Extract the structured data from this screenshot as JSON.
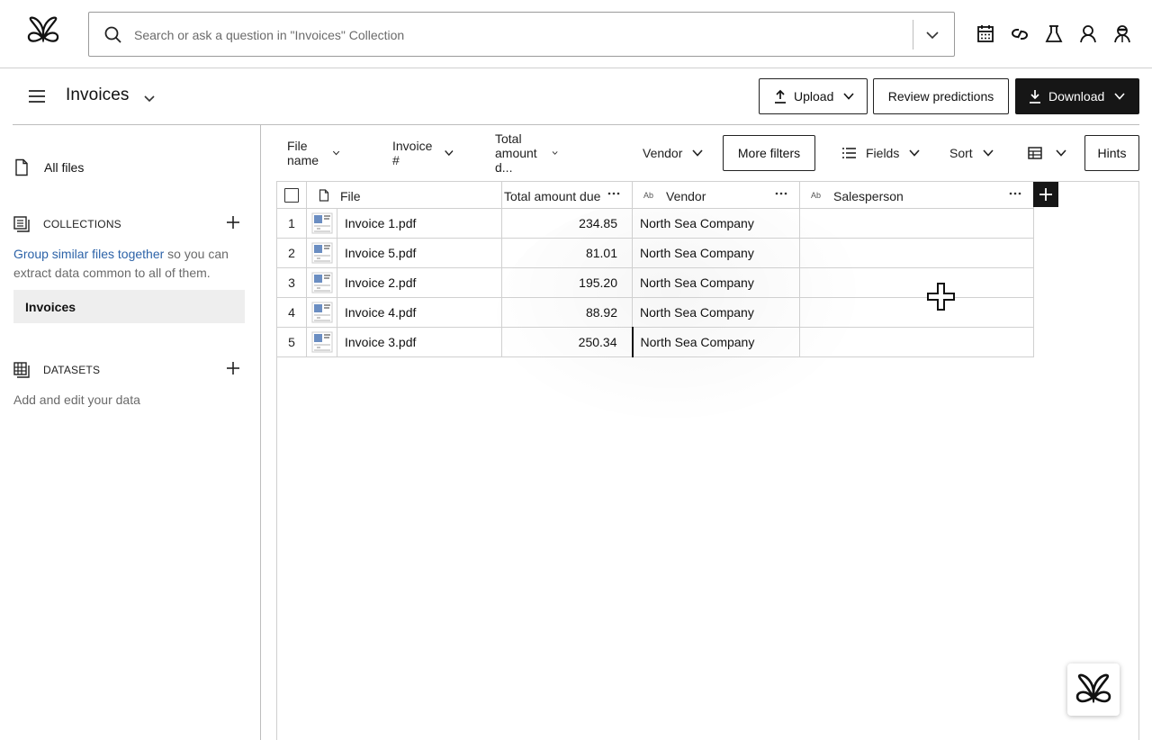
{
  "app": {
    "logo_icon": "butterfly-logo-icon"
  },
  "search": {
    "placeholder": "Search or ask a question in \"Invoices\" Collection",
    "value": ""
  },
  "top_icons": [
    "calendar-icon",
    "link-icon",
    "flask-icon",
    "user-icon",
    "agent-icon"
  ],
  "header": {
    "title": "Invoices",
    "upload_label": "Upload",
    "review_label": "Review predictions",
    "download_label": "Download"
  },
  "sidebar": {
    "all_files": "All files",
    "collections_header": "COLLECTIONS",
    "collections_link": "Group similar files together",
    "collections_desc": " so you can extract data common to all of them.",
    "collections_items": [
      "Invoices"
    ],
    "datasets_header": "DATASETS",
    "datasets_desc": "Add and edit your data"
  },
  "filters": {
    "file_name": "File name",
    "invoice_no": "Invoice #",
    "total_amount": "Total amount d...",
    "vendor": "Vendor",
    "more_filters": "More filters",
    "fields": "Fields",
    "sort": "Sort",
    "hints": "Hints"
  },
  "table": {
    "columns": {
      "file": "File",
      "total": "Total amount due",
      "vendor_type": "Ab",
      "vendor": "Vendor",
      "sales_type": "Ab",
      "salesperson": "Salesperson"
    },
    "rows": [
      {
        "num": "1",
        "file": "Invoice 1.pdf",
        "total": "234.85",
        "vendor": "North Sea Company",
        "salesperson": ""
      },
      {
        "num": "2",
        "file": "Invoice 5.pdf",
        "total": "81.01",
        "vendor": "North Sea Company",
        "salesperson": ""
      },
      {
        "num": "3",
        "file": "Invoice 2.pdf",
        "total": "195.20",
        "vendor": "North Sea Company",
        "salesperson": ""
      },
      {
        "num": "4",
        "file": "Invoice 4.pdf",
        "total": "88.92",
        "vendor": "North Sea Company",
        "salesperson": ""
      },
      {
        "num": "5",
        "file": "Invoice 3.pdf",
        "total": "250.34",
        "vendor": "North Sea Company",
        "salesperson": ""
      }
    ]
  },
  "colors": {
    "primary_dark": "#161616",
    "link_blue": "#2d63a8",
    "selected_bg": "#eeeeee",
    "border": "#d0d0d0"
  }
}
